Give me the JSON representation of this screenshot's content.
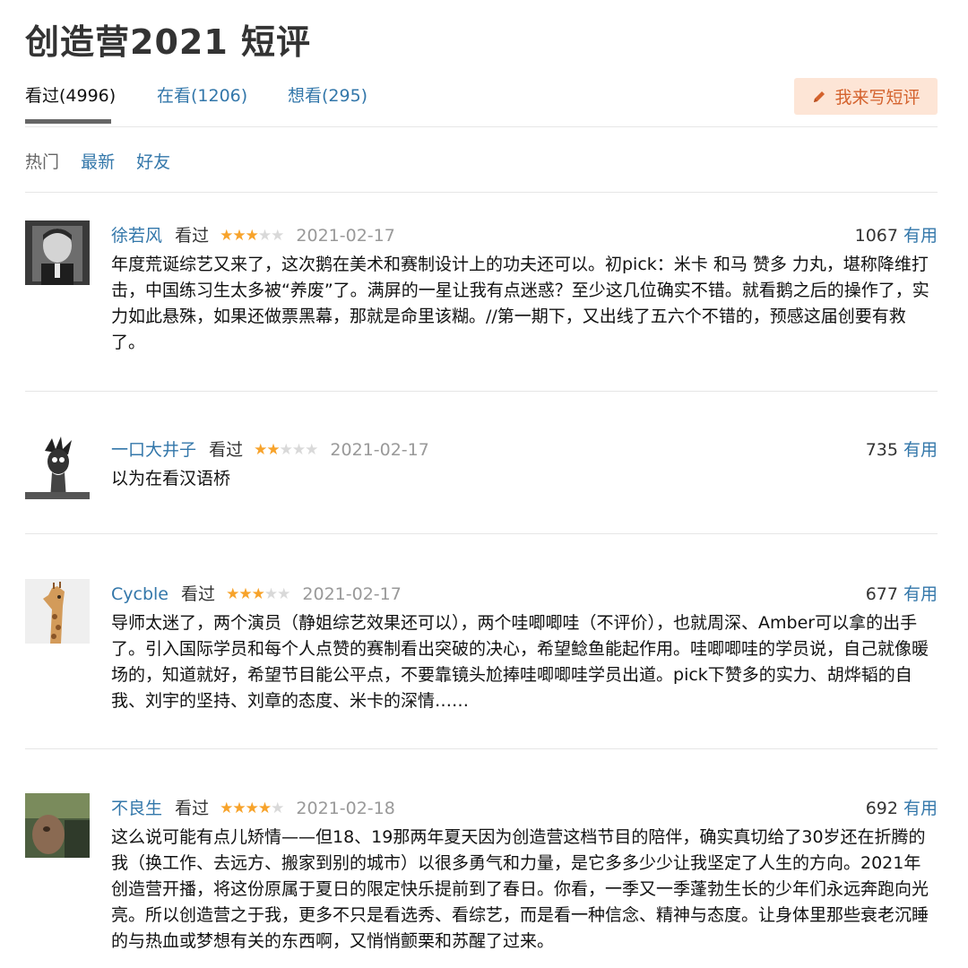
{
  "page": {
    "title": "创造营2021 短评"
  },
  "status_tabs": [
    {
      "label": "看过(4996)"
    },
    {
      "label": "在看(1206)"
    },
    {
      "label": "想看(295)"
    }
  ],
  "write_button": {
    "label": "我来写短评",
    "icon": "pencil-icon"
  },
  "sort_tabs": [
    {
      "label": "热门"
    },
    {
      "label": "最新"
    },
    {
      "label": "好友"
    }
  ],
  "comments": [
    {
      "user": "徐若风",
      "status": "看过",
      "rating": 3,
      "date": "2021-02-17",
      "votes": "1067",
      "useful": "有用",
      "text": "年度荒诞综艺又来了，这次鹅在美术和赛制设计上的功夫还可以。初pick：米卡 和马 赞多 力丸，堪称降维打击，中国练习生太多被“养废”了。满屏的一星让我有点迷惑？至少这几位确实不错。就看鹅之后的操作了，实力如此悬殊，如果还做票黑幕，那就是命里该糊。//第一期下，又出线了五六个不错的，预感这届创要有救了。"
    },
    {
      "user": "一口大井子",
      "status": "看过",
      "rating": 2,
      "date": "2021-02-17",
      "votes": "735",
      "useful": "有用",
      "text": "以为在看汉语桥"
    },
    {
      "user": "Cycble",
      "status": "看过",
      "rating": 3,
      "date": "2021-02-17",
      "votes": "677",
      "useful": "有用",
      "text": "导师太迷了，两个演员（静姐综艺效果还可以），两个哇唧唧哇（不评价），也就周深、Amber可以拿的出手了。引入国际学员和每个人点赞的赛制看出突破的决心，希望鲶鱼能起作用。哇唧唧哇的学员说，自己就像暖场的，知道就好，希望节目能公平点，不要靠镜头尬捧哇唧唧哇学员出道。pick下赞多的实力、胡烨韬的自我、刘宇的坚持、刘章的态度、米卡的深情……"
    },
    {
      "user": "不良生",
      "status": "看过",
      "rating": 4,
      "date": "2021-02-18",
      "votes": "692",
      "useful": "有用",
      "text": "这么说可能有点儿矫情——但18、19那两年夏天因为创造营这档节目的陪伴，确实真切给了30岁还在折腾的我（换工作、去远方、搬家到别的城市）以很多勇气和力量，是它多多少少让我坚定了人生的方向。2021年创造营开播，将这份原属于夏日的限定快乐提前到了春日。你看，一季又一季蓬勃生长的少年们永远奔跑向光亮。所以创造营之于我，更多不只是看选秀、看综艺，而是看一种信念、精神与态度。让身体里那些衰老沉睡的与热血或梦想有关的东西啊，又悄悄颤栗和苏醒了过来。"
    }
  ]
}
